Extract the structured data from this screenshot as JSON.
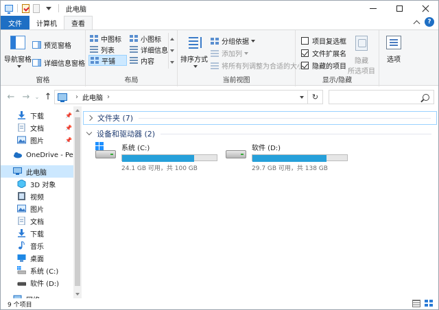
{
  "window": {
    "title": "此电脑"
  },
  "tabs": {
    "file": "文件",
    "computer": "计算机",
    "view": "查看"
  },
  "ribbon": {
    "pane": {
      "nav_pane": "导航窗格",
      "preview": "预览窗格",
      "details": "详细信息窗格",
      "caption": "窗格"
    },
    "layout": {
      "items": [
        "中图标",
        "小图标",
        "列表",
        "详细信息",
        "平铺",
        "内容"
      ],
      "selected": "平铺",
      "caption": "布局"
    },
    "current_view": {
      "sort": "排序方式",
      "group": "分组依据",
      "add_column": "添加列",
      "fit_columns": "将所有列调整为合适的大小",
      "caption": "当前视图"
    },
    "show_hide": {
      "item_checkbox": "项目复选框",
      "item_checkbox_checked": false,
      "extensions": "文件扩展名",
      "extensions_checked": true,
      "hidden_items": "隐藏的项目",
      "hidden_items_checked": true,
      "hide": "隐藏",
      "selected_items": "所选项目",
      "caption": "显示/隐藏"
    },
    "options": "选项"
  },
  "address": {
    "location": "此电脑"
  },
  "nav_pane": {
    "quick_access": [
      {
        "label": "下载",
        "icon": "download-icon",
        "pinned": true
      },
      {
        "label": "文档",
        "icon": "document-icon",
        "pinned": true
      },
      {
        "label": "图片",
        "icon": "pictures-icon",
        "pinned": true
      }
    ],
    "onedrive": "OneDrive - Perso",
    "this_pc": "此电脑",
    "this_pc_children": [
      {
        "label": "3D 对象",
        "icon": "3d-objects-icon"
      },
      {
        "label": "视频",
        "icon": "videos-icon"
      },
      {
        "label": "图片",
        "icon": "pictures-icon"
      },
      {
        "label": "文档",
        "icon": "document-icon"
      },
      {
        "label": "下载",
        "icon": "download-icon"
      },
      {
        "label": "音乐",
        "icon": "music-icon"
      },
      {
        "label": "桌面",
        "icon": "desktop-icon"
      },
      {
        "label": "系统 (C:)",
        "icon": "drive-c-icon"
      },
      {
        "label": "软件 (D:)",
        "icon": "drive-d-icon"
      }
    ],
    "network": "网络"
  },
  "content": {
    "folders_header": "文件夹 (7)",
    "drives_header": "设备和驱动器 (2)",
    "drives": [
      {
        "name": "系统 (C:)",
        "free": "24.1 GB 可用，共 100 GB",
        "used_fraction": 0.759
      },
      {
        "name": "软件 (D:)",
        "free": "29.7 GB 可用，共 138 GB",
        "used_fraction": 0.785
      }
    ]
  },
  "status": {
    "count": "9 个项目"
  },
  "colors": {
    "accent": "#1e6fc4",
    "selection": "#cce8ff",
    "drive_bar": "#26a0da"
  }
}
